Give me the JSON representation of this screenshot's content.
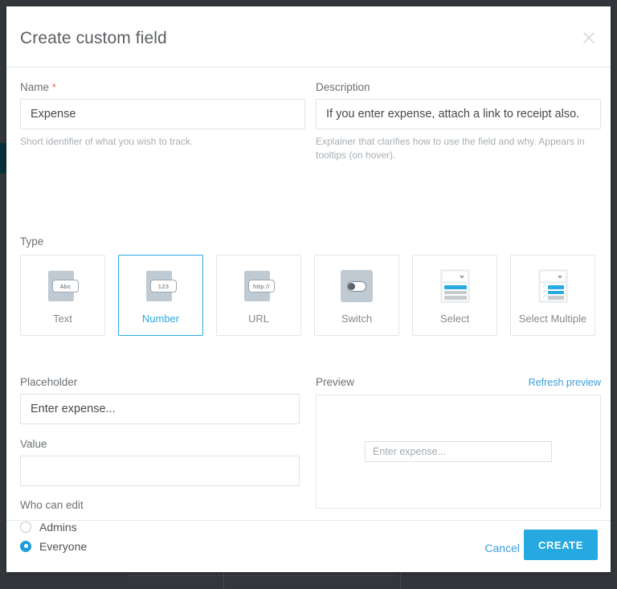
{
  "dialog": {
    "title": "Create custom field",
    "close_icon": "close-icon"
  },
  "form": {
    "name": {
      "label": "Name",
      "required_marker": "*",
      "value": "Expense",
      "placeholder": "",
      "hint": "Short identifier of what you wish to track."
    },
    "description": {
      "label": "Description",
      "value": "If you enter expense, attach a link to receipt also.",
      "placeholder": "",
      "hint": "Explainer that clarifies how to use the field and why. Appears in tooltips (on hover)."
    },
    "type": {
      "label": "Type",
      "selected": "Number",
      "options": [
        {
          "label": "Text",
          "icon": "text-input-icon",
          "glyph_text": "Abc",
          "selected": false
        },
        {
          "label": "Number",
          "icon": "number-input-icon",
          "glyph_text": "123",
          "selected": true
        },
        {
          "label": "URL",
          "icon": "url-input-icon",
          "glyph_text": "http://",
          "selected": false
        },
        {
          "label": "Switch",
          "icon": "toggle-switch-icon",
          "glyph_text": "",
          "selected": false
        },
        {
          "label": "Select",
          "icon": "dropdown-select-icon",
          "glyph_text": "",
          "selected": false
        },
        {
          "label": "Select Multiple",
          "icon": "multi-select-icon",
          "glyph_text": "",
          "selected": false
        }
      ]
    },
    "placeholder_field": {
      "label": "Placeholder",
      "value": "Enter expense...",
      "placeholder": ""
    },
    "value_field": {
      "label": "Value",
      "value": "",
      "placeholder": ""
    },
    "who_can_edit": {
      "label": "Who can edit",
      "options": [
        {
          "label": "Admins",
          "selected": false
        },
        {
          "label": "Everyone",
          "selected": true
        }
      ]
    }
  },
  "preview": {
    "label": "Preview",
    "refresh_label": "Refresh preview",
    "input_placeholder": "Enter expense..."
  },
  "footer": {
    "cancel_label": "Cancel",
    "create_label": "CREATE"
  },
  "colors": {
    "accent": "#29abe2",
    "link": "#3b9fda",
    "primary_button": "#25a9e0",
    "required": "#f0694a",
    "border": "#e2e6ea",
    "backdrop": "#33363a"
  }
}
